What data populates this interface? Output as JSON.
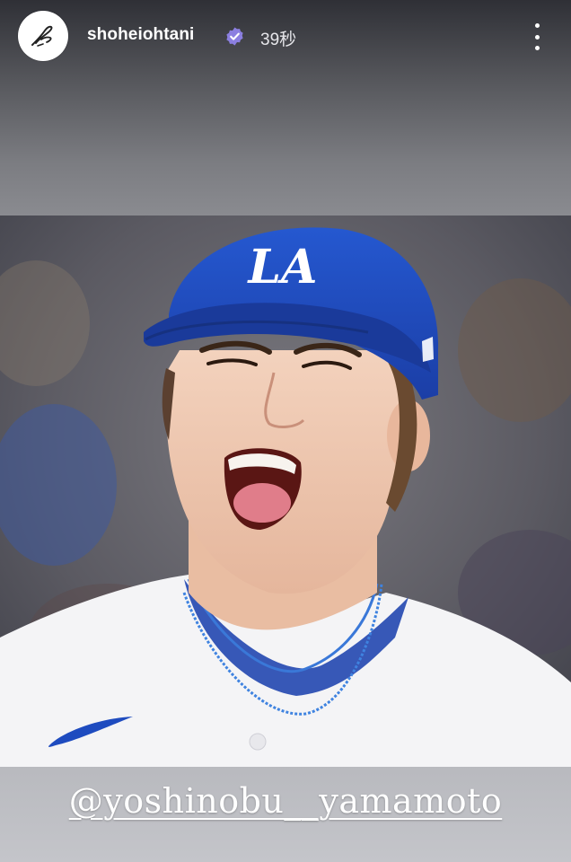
{
  "story": {
    "username": "shoheiohtani",
    "verified": true,
    "time_ago": "39秒",
    "more_icon": "more-vertical-icon",
    "avatar_icon": "signature-avatar-icon"
  },
  "photo": {
    "cap_logo": "LA",
    "cap_color": "#1e4bbf",
    "jersey_color": "#f4f4f6"
  },
  "mention": {
    "text": "@yoshinobu__yamamoto"
  }
}
